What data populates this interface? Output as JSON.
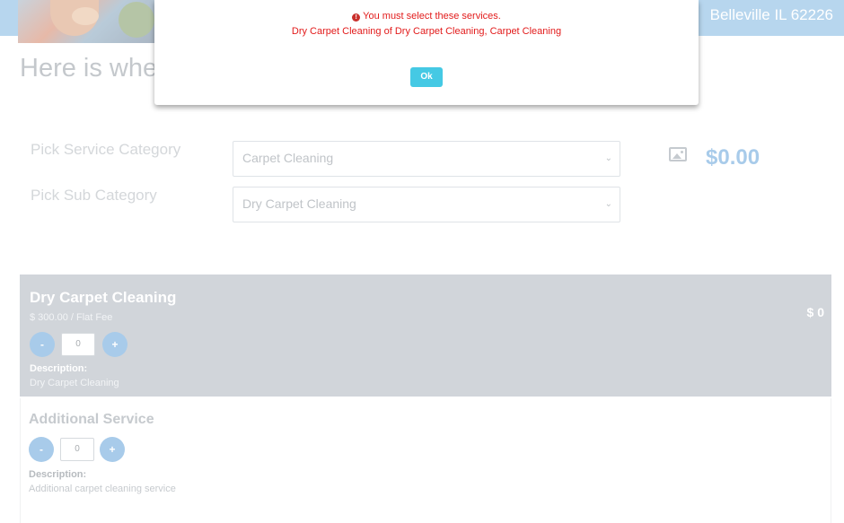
{
  "header": {
    "location": "Belleville IL 62226"
  },
  "intro": {
    "heading_visible": "Here is whe"
  },
  "form": {
    "category_label": "Pick Service Category",
    "category_value": "Carpet Cleaning",
    "subcategory_label": "Pick Sub Category",
    "subcategory_value": "Dry Carpet Cleaning",
    "total_price": "$0.00"
  },
  "services": [
    {
      "title": "Dry Carpet Cleaning",
      "rate": "$ 300.00 / Flat Fee",
      "quantity": "0",
      "minus_label": "-",
      "plus_label": "+",
      "subtotal": "$ 0",
      "description_label": "Description:",
      "description": "Dry Carpet Cleaning"
    },
    {
      "title": "Additional Service",
      "quantity": "0",
      "minus_label": "-",
      "plus_label": "+",
      "description_label": "Description:",
      "description": "Additional carpet cleaning service"
    }
  ],
  "modal": {
    "icon_glyph": "!",
    "message": "You must select these services.",
    "detail": "Dry Carpet Cleaning of Dry Carpet Cleaning, Carpet Cleaning",
    "ok_label": "Ok"
  },
  "colors": {
    "header_bg": "#b7d6ee",
    "accent": "#a8cbea",
    "error": "#e21b1b",
    "ok_button": "#45c9e4",
    "active_card": "#d1d5da"
  }
}
